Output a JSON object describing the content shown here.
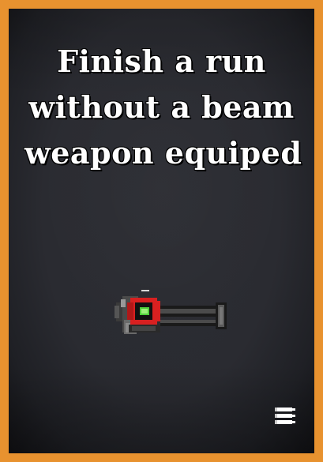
{
  "achievement": {
    "title_lines": [
      "Finish a run",
      "without a beam",
      "weapon equiped"
    ],
    "icon": "beam-cannon-weapon-icon",
    "corner_icon": "bullets-menu-icon"
  },
  "colors": {
    "border": "#e8922f",
    "background": "#2a2b31",
    "text": "#ffffff"
  }
}
